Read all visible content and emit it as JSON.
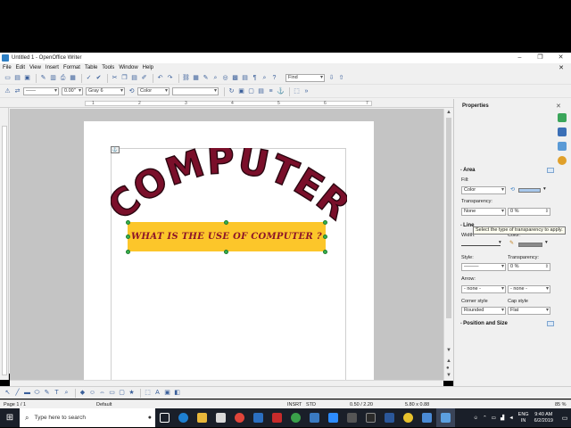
{
  "window": {
    "title": "Untitled 1 - OpenOffice Writer",
    "minimize": "–",
    "maximize": "❐",
    "close": "✕"
  },
  "menu": [
    "File",
    "Edit",
    "View",
    "Insert",
    "Format",
    "Table",
    "Tools",
    "Window",
    "Help"
  ],
  "menu_close": "✕",
  "toolbar": {
    "find_placeholder": "Find"
  },
  "line_toolbar": {
    "line_width": "0.00\"",
    "area_color": "Gray 6",
    "area_style": "Color"
  },
  "ruler_numbers": [
    "1",
    "2",
    "3",
    "4",
    "5",
    "6",
    "7"
  ],
  "document": {
    "fontwork_text": "COMPUTER",
    "textbox_text": "WHAT IS THE USE OF COMPUTER ?"
  },
  "colors": {
    "fontwork": "#7a0f2a",
    "textbox_fill": "#fcc62a",
    "textbox_text": "#8c1429"
  },
  "sidebar": {
    "title": "Properties",
    "area": {
      "heading": "Area",
      "fill_label": "Fill:",
      "fill_value": "Color",
      "transparency_label": "Transparency:",
      "transparency_type": "None",
      "transparency_value": "0 %"
    },
    "tooltip": "Select the type of transparency to apply.",
    "line": {
      "heading": "Line",
      "width_label": "Width:",
      "color_label": "Color:",
      "style_label": "Style:",
      "transparency_label": "Transparency:",
      "transparency_value": "0 %",
      "arrow_label": "Arrow:",
      "arrow_start": "- none -",
      "arrow_end": "- none -",
      "corner_label": "Corner style",
      "corner_value": "Rounded",
      "cap_label": "Cap style",
      "cap_value": "Flat"
    },
    "position_heading": "Position and Size"
  },
  "status": {
    "page": "Page 1 / 1",
    "style": "Default",
    "insert": "INSRT",
    "std": "STD",
    "position": "0.50 / 2.20",
    "size": "5.80 x 0.88",
    "zoom": "85 %"
  },
  "taskbar": {
    "search_placeholder": "Type here to search",
    "lang1": "ENG",
    "lang2": "IN",
    "time": "9:40 AM",
    "date": "6/2/2019"
  }
}
